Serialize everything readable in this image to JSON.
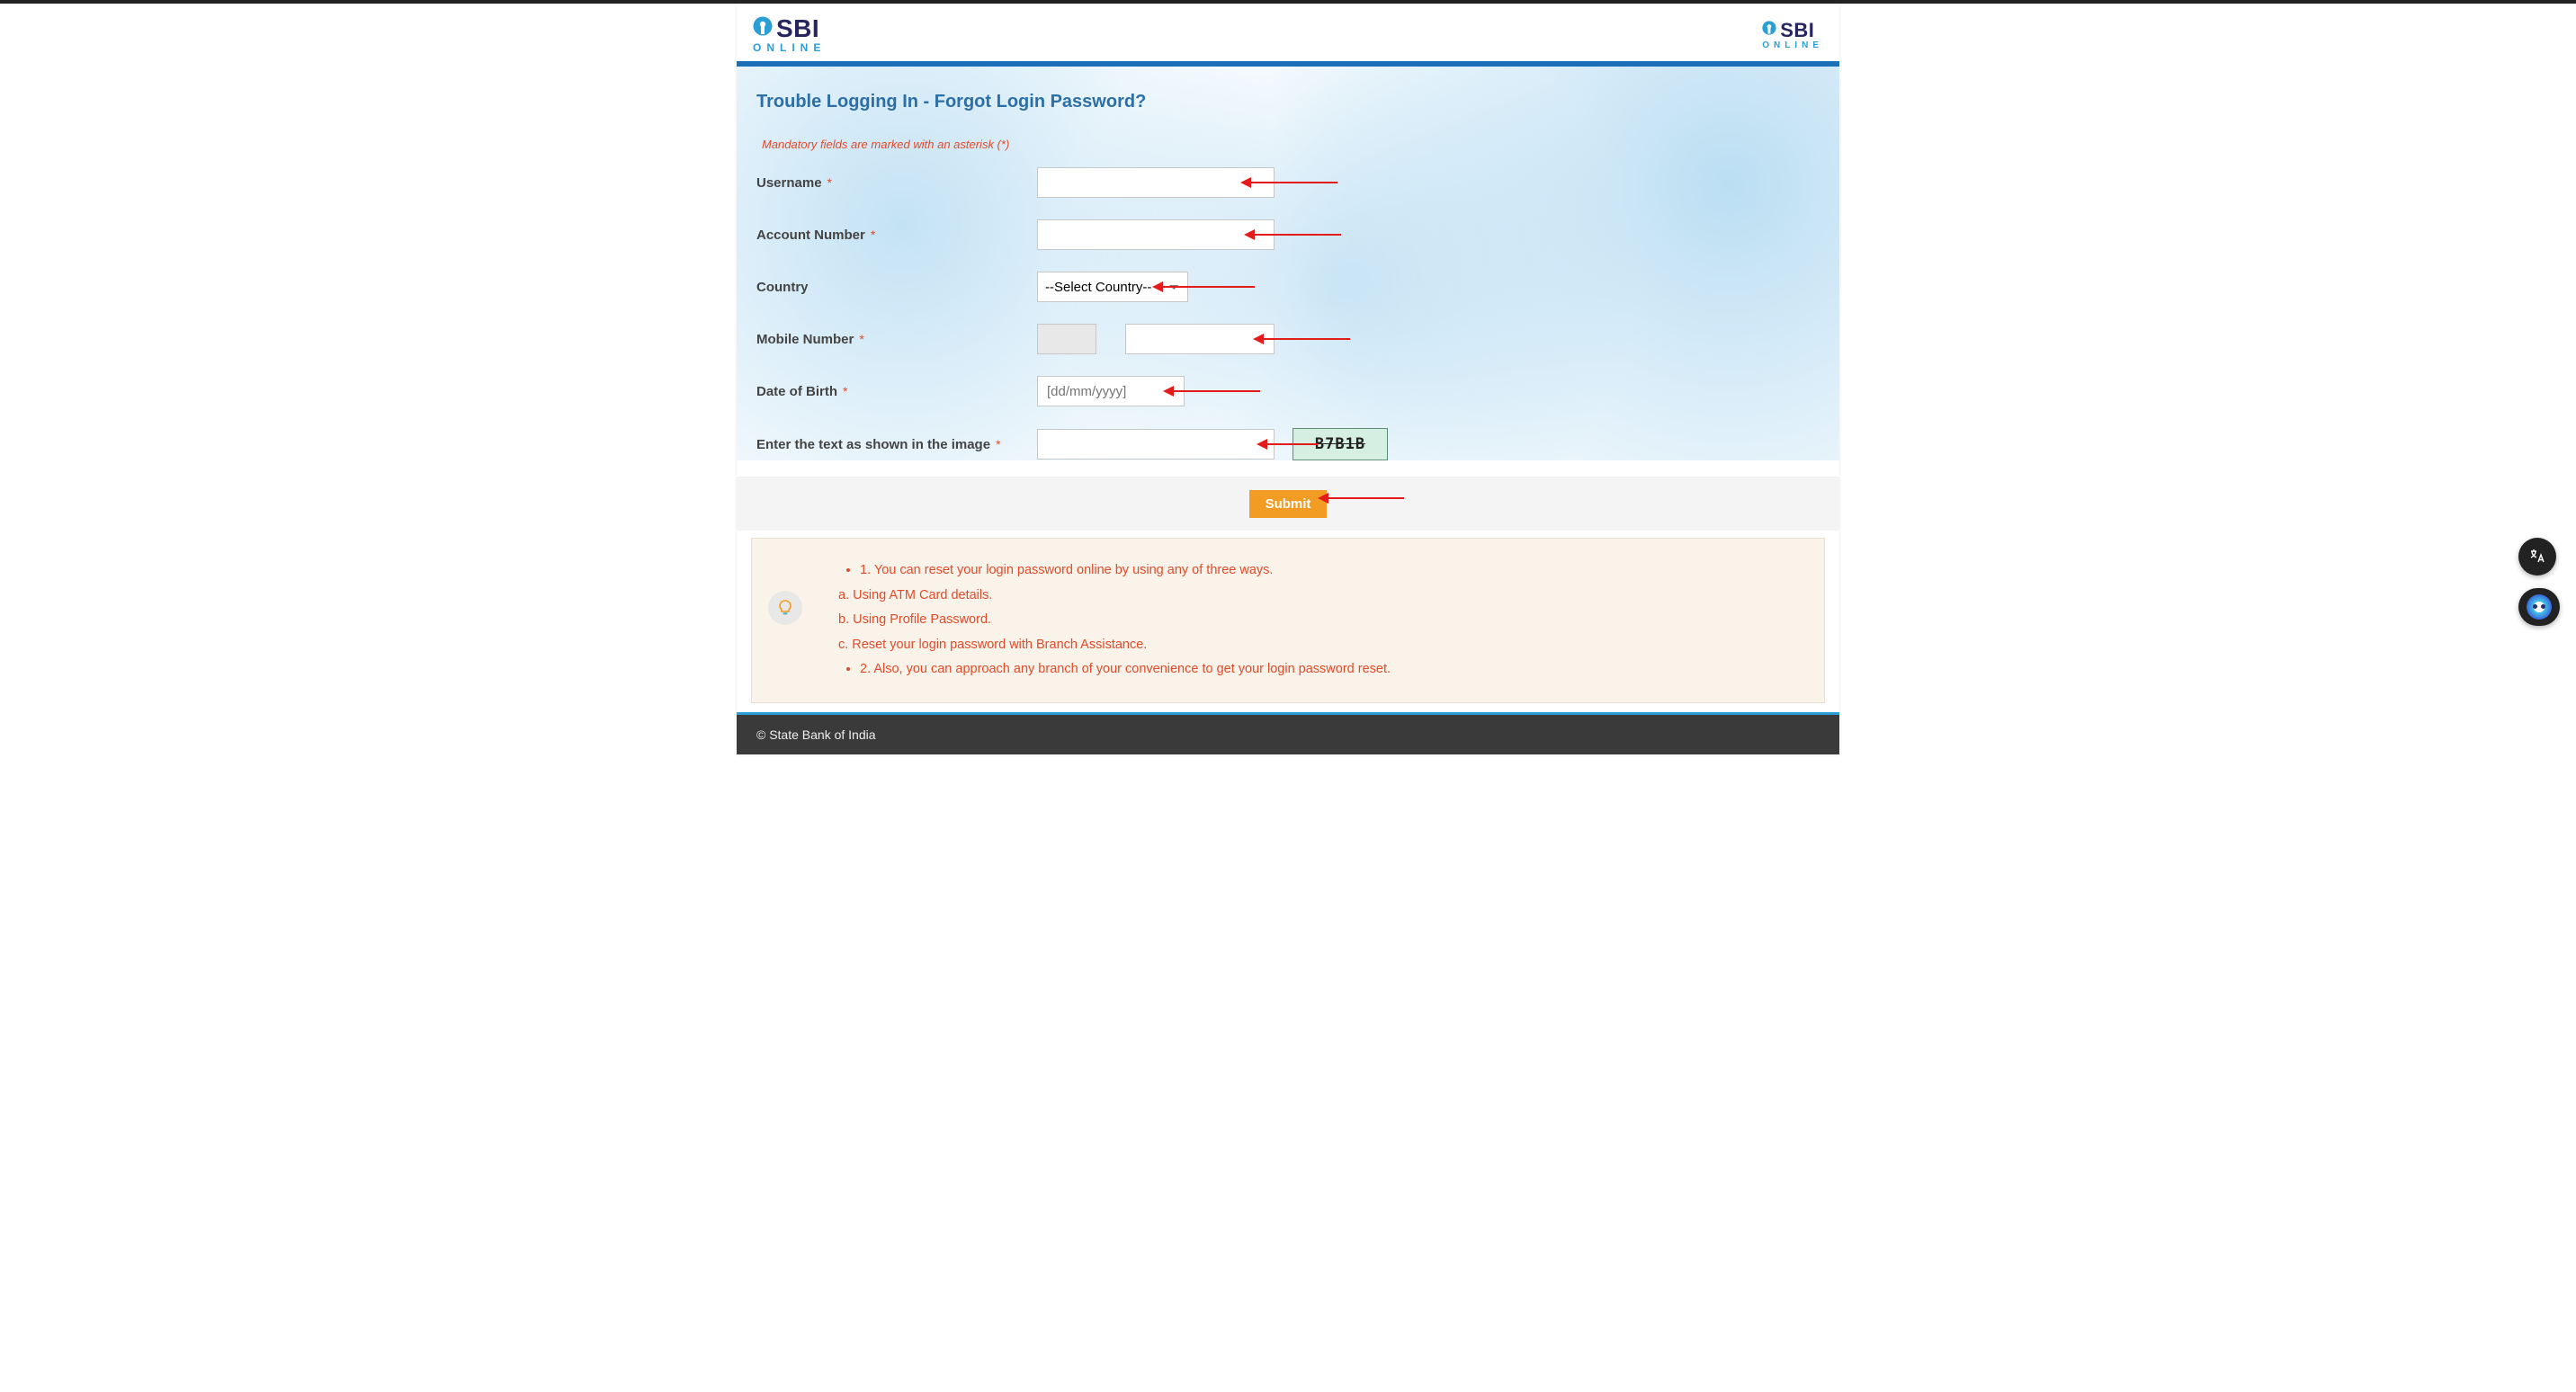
{
  "brand": {
    "main": "SBI",
    "sub": "ONLINE"
  },
  "page_title": "Trouble Logging In - Forgot Login Password?",
  "mandatory_note": "Mandatory fields are marked with an asterisk (*)",
  "fields": {
    "username": {
      "label": "Username"
    },
    "account": {
      "label": "Account Number"
    },
    "country": {
      "label": "Country",
      "selected": "--Select Country--"
    },
    "mobile": {
      "label": "Mobile Number"
    },
    "dob": {
      "label": "Date of Birth",
      "placeholder": "[dd/mm/yyyy]"
    },
    "captcha": {
      "label": "Enter the text as shown in the image",
      "image_text": "B7B1B"
    }
  },
  "submit_label": "Submit",
  "info": {
    "line1": "1. You can reset your login password online by using any of three ways.",
    "sub_a": "a. Using ATM Card details.",
    "sub_b": "b. Using Profile Password.",
    "sub_c": "c. Reset your login password with Branch Assistance.",
    "line2": "2. Also, you can approach any branch of your convenience to get your login password reset."
  },
  "footer": "© State Bank of India"
}
